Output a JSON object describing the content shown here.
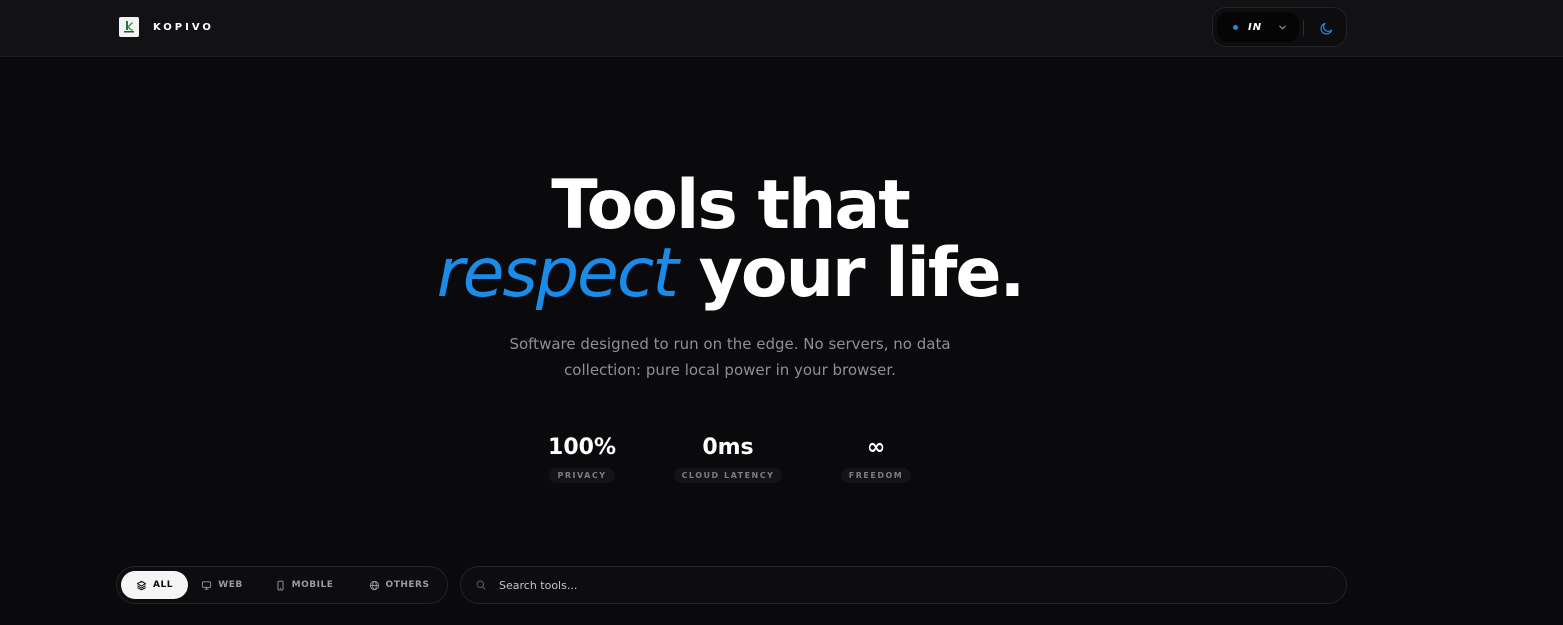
{
  "header": {
    "brand_name": "KOPIVO",
    "language": {
      "code": "IN"
    }
  },
  "hero": {
    "line1": "Tools that",
    "accent": "respect",
    "line2_rest": " your life."
  },
  "subtitle": {
    "line1": "Software designed to run on the edge. No servers, no data",
    "line2": "collection: pure local power in your browser."
  },
  "stats": [
    {
      "value": "100%",
      "label": "PRIVACY"
    },
    {
      "value": "0ms",
      "label": "CLOUD LATENCY"
    },
    {
      "value": "∞",
      "label": "FREEDOM"
    }
  ],
  "filters": [
    {
      "label": "ALL",
      "active": true
    },
    {
      "label": "WEB"
    },
    {
      "label": "MOBILE"
    },
    {
      "label": "OTHERS"
    }
  ],
  "search": {
    "placeholder": "Search tools..."
  },
  "icons": {
    "logo": "kopivo-logo",
    "language_dot": "status-dot",
    "language_chevron": "chevron-down-icon",
    "theme": "moon-icon",
    "filter_all": "layers-icon",
    "filter_web": "monitor-icon",
    "filter_mobile": "smartphone-icon",
    "filter_others": "globe-icon",
    "search": "search-icon"
  },
  "colors": {
    "background": "#0a0a0c",
    "header": "#121214",
    "accent": "#1a8be6",
    "text": "#ffffff",
    "muted": "#8e8f96",
    "active_filter_bg": "#f5f5f5"
  }
}
